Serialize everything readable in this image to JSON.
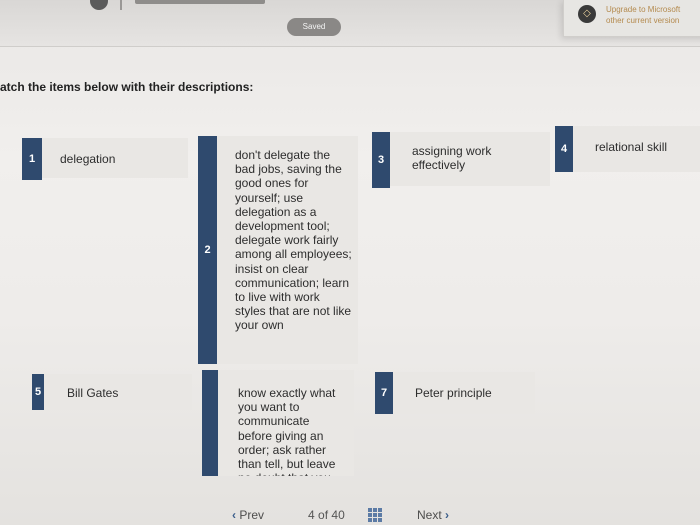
{
  "header": {
    "saved_label": "Saved",
    "upgrade_line1": "Upgrade to Microsoft",
    "upgrade_line2": "other current version"
  },
  "instructions": "atch the items below with their descriptions:",
  "items": [
    {
      "number": "1",
      "text": "delegation"
    },
    {
      "number": "2",
      "text": "don't delegate the bad jobs, saving the good ones for yourself; use delegation as a development tool; delegate work fairly among all employees; insist on clear communication; learn to live with work styles that are not like your own"
    },
    {
      "number": "3",
      "text": "assigning work effectively"
    },
    {
      "number": "4",
      "text": "relational skill"
    },
    {
      "number": "5",
      "text": "Bill Gates"
    },
    {
      "number": "",
      "text": "know exactly what you want to communicate before giving an order; ask rather than tell, but leave no doubt that you"
    },
    {
      "number": "7",
      "text": "Peter principle"
    }
  ],
  "pager": {
    "prev_label": "Prev",
    "current": "4",
    "of_label": "of",
    "total": "40",
    "next_label": "Next"
  },
  "icons": {
    "prev": "chevron-left-icon",
    "next": "chevron-right-icon",
    "grid": "grid-icon",
    "upgrade": "upgrade-icon"
  },
  "colors": {
    "badge": "#2f4a6e",
    "accent": "#3b5e8c",
    "upgrade_text": "#b48a4e"
  }
}
